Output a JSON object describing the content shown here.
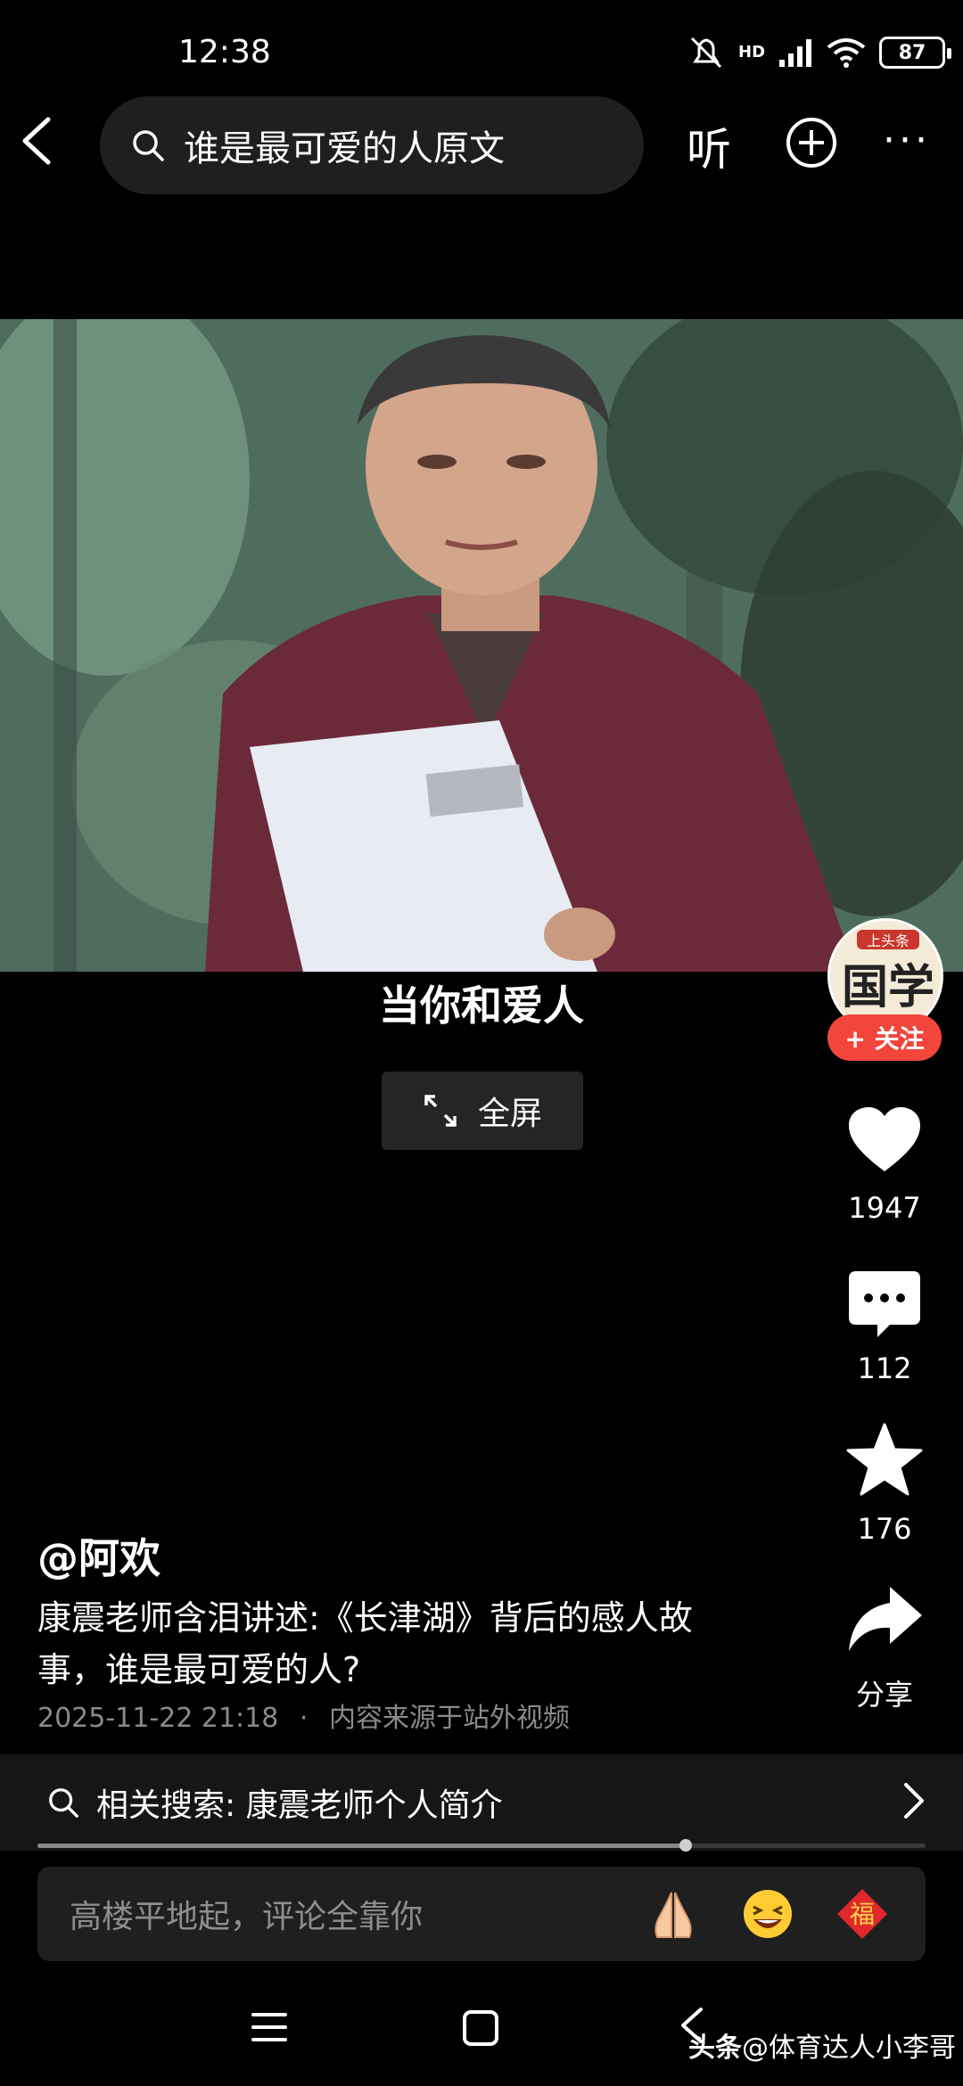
{
  "status_bar": {
    "time": "12:38",
    "network": "HD",
    "battery": "87"
  },
  "top_bar": {
    "search_text": "谁是最可爱的人原文",
    "listen_label": "听",
    "more_label": "···"
  },
  "video": {
    "subtitle": "当你和爱人",
    "fullscreen_label": "全屏"
  },
  "author": {
    "avatar_text": "国学",
    "avatar_top_text": "上头条",
    "follow_label": "+ 关注"
  },
  "actions": {
    "likes": "1947",
    "comments": "112",
    "favorites": "176",
    "share_label": "分享"
  },
  "post": {
    "author_name": "@阿欢",
    "description": "康震老师含泪讲述:《长津湖》背后的感人故事，谁是最可爱的人?",
    "timestamp": "2025-11-22 21:18",
    "meta_separator": "·",
    "source_note": "内容来源于站外视频"
  },
  "related_search": {
    "label": "相关搜索: 康震老师个人简介"
  },
  "playback": {
    "progress": 0.73
  },
  "comment": {
    "placeholder": "高楼平地起，评论全靠你",
    "fu_char": "福"
  },
  "watermark": {
    "brand": "头条",
    "handle": "@体育达人小李哥"
  },
  "colors": {
    "accent_red": "#f2453b",
    "background": "#000000"
  }
}
